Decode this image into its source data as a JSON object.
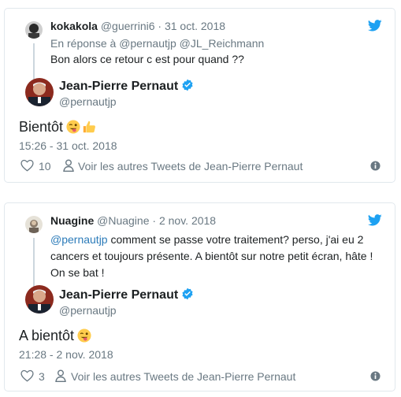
{
  "tweets": [
    {
      "parent": {
        "name": "kokakola",
        "handle": "@guerrini6",
        "date": "31 oct. 2018",
        "reply_prefix": "En réponse à",
        "reply_mentions": "@pernautjp @JL_Reichmann",
        "text": "Bon alors ce retour c est pour quand ??"
      },
      "main": {
        "name": "Jean-Pierre Pernaut",
        "handle": "@pernautjp",
        "text": "Bientôt",
        "timestamp": "15:26 - 31 oct. 2018",
        "likes": "10",
        "more_link": "Voir les autres Tweets de Jean-Pierre Pernaut"
      }
    },
    {
      "parent": {
        "name": "Nuagine",
        "handle": "@Nuagine",
        "date": "2 nov. 2018",
        "text_mention": "@pernautjp",
        "text_line1": " comment se passe votre traitement? perso, j'ai eu 2",
        "text_line2": "cancers et toujours présente. A bientôt sur notre petit écran, hâte !",
        "text_line3": "On se bat !"
      },
      "main": {
        "name": "Jean-Pierre Pernaut",
        "handle": "@pernautjp",
        "text": "A bientôt",
        "timestamp": "21:28 - 2 nov. 2018",
        "likes": "3",
        "more_link": "Voir les autres Tweets de Jean-Pierre Pernaut"
      }
    }
  ],
  "colors": {
    "twitter_blue": "#1da1f2",
    "muted": "#697882",
    "link": "#2b7bb9",
    "border": "#e1e8ed"
  },
  "icons": [
    "twitter-bird-icon",
    "verified-badge-icon",
    "heart-icon",
    "person-icon",
    "info-icon",
    "wink-tongue-emoji",
    "thumbs-up-emoji"
  ]
}
